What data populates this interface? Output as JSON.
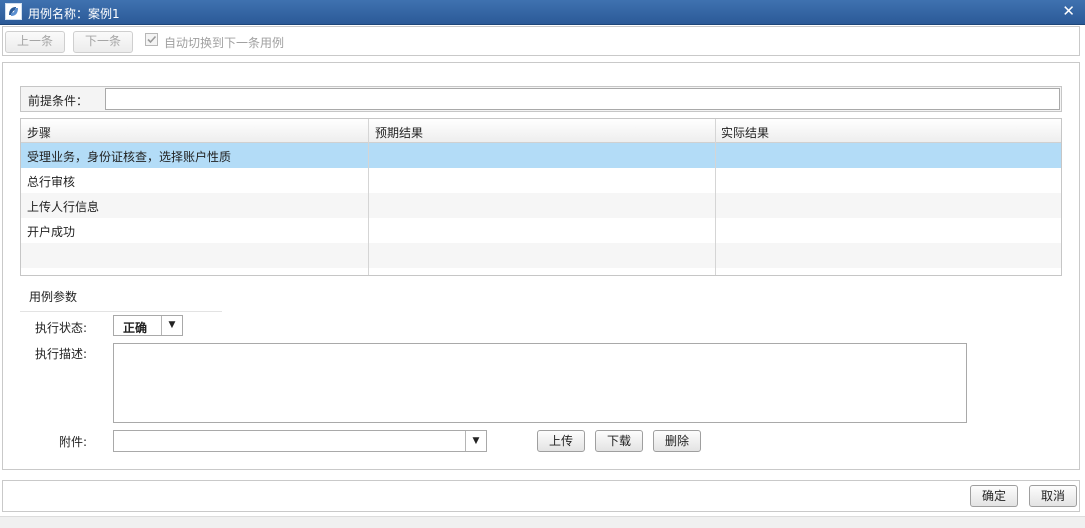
{
  "window": {
    "title": "用例名称：案例1",
    "close_symbol": "✕",
    "colors": {
      "titlebar": "#2f62a3",
      "selected_row": "#b3dcf7"
    }
  },
  "toolbar": {
    "prev_label": "上一条",
    "next_label": "下一条",
    "auto_switch_label": "自动切换到下一条用例",
    "auto_switch_checked": true
  },
  "precondition": {
    "label": "前提条件：",
    "value": ""
  },
  "steps_table": {
    "headers": [
      "步骤",
      "预期结果",
      "实际结果"
    ],
    "rows": [
      {
        "step": "受理业务，身份证核查，选择账户性质",
        "expected": "",
        "actual": "",
        "selected": true
      },
      {
        "step": "总行审核",
        "expected": "",
        "actual": ""
      },
      {
        "step": "上传人行信息",
        "expected": "",
        "actual": ""
      },
      {
        "step": "开户成功",
        "expected": "",
        "actual": ""
      }
    ]
  },
  "params": {
    "section_title": "用例参数",
    "status_label": "执行状态:",
    "status_value": "正确",
    "desc_label": "执行描述:",
    "desc_value": "",
    "attach_label": "附件:",
    "attach_value": "",
    "upload_label": "上传",
    "download_label": "下载",
    "delete_label": "删除"
  },
  "footer": {
    "ok_label": "确定",
    "cancel_label": "取消"
  },
  "icons": {
    "app": "app-logo-icon",
    "checkbox": "checkbox-icon",
    "dropdown": "chevron-down-icon",
    "close": "close-icon"
  }
}
